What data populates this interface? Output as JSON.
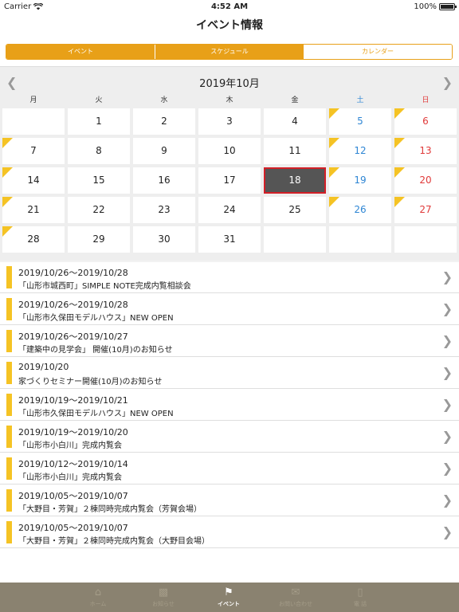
{
  "status": {
    "carrier": "Carrier",
    "time": "4:52 AM",
    "battery": "100%"
  },
  "nav": {
    "title": "イベント情報"
  },
  "segments": [
    "イベント",
    "スケジュール",
    "カレンダー"
  ],
  "calendar": {
    "month": "2019年10月",
    "weekdays": [
      "月",
      "火",
      "水",
      "木",
      "金",
      "土",
      "日"
    ],
    "days": [
      {
        "d": "",
        "flag": false
      },
      {
        "d": "1",
        "flag": false
      },
      {
        "d": "2",
        "flag": false
      },
      {
        "d": "3",
        "flag": false
      },
      {
        "d": "4",
        "flag": false
      },
      {
        "d": "5",
        "flag": true
      },
      {
        "d": "6",
        "flag": true
      },
      {
        "d": "7",
        "flag": true
      },
      {
        "d": "8",
        "flag": false
      },
      {
        "d": "9",
        "flag": false
      },
      {
        "d": "10",
        "flag": false
      },
      {
        "d": "11",
        "flag": false
      },
      {
        "d": "12",
        "flag": true
      },
      {
        "d": "13",
        "flag": true
      },
      {
        "d": "14",
        "flag": true
      },
      {
        "d": "15",
        "flag": false
      },
      {
        "d": "16",
        "flag": false
      },
      {
        "d": "17",
        "flag": false
      },
      {
        "d": "18",
        "flag": false,
        "selected": true
      },
      {
        "d": "19",
        "flag": true
      },
      {
        "d": "20",
        "flag": true
      },
      {
        "d": "21",
        "flag": true
      },
      {
        "d": "22",
        "flag": false
      },
      {
        "d": "23",
        "flag": false
      },
      {
        "d": "24",
        "flag": false
      },
      {
        "d": "25",
        "flag": false
      },
      {
        "d": "26",
        "flag": true
      },
      {
        "d": "27",
        "flag": true
      },
      {
        "d": "28",
        "flag": true
      },
      {
        "d": "29",
        "flag": false
      },
      {
        "d": "30",
        "flag": false
      },
      {
        "d": "31",
        "flag": false
      },
      {
        "d": "",
        "flag": false
      },
      {
        "d": "",
        "flag": false
      },
      {
        "d": "",
        "flag": false
      }
    ]
  },
  "events": [
    {
      "date": "2019/10/26〜2019/10/28",
      "title": "「山形市城西町」SIMPLE NOTE完成内覧相談会"
    },
    {
      "date": "2019/10/26〜2019/10/28",
      "title": "「山形市久保田モデルハウス」NEW OPEN"
    },
    {
      "date": "2019/10/26〜2019/10/27",
      "title": "「建築中の見学会」 開催(10月)のお知らせ"
    },
    {
      "date": "2019/10/20",
      "title": "家づくりセミナー開催(10月)のお知らせ"
    },
    {
      "date": "2019/10/19〜2019/10/21",
      "title": "「山形市久保田モデルハウス」NEW OPEN"
    },
    {
      "date": "2019/10/19〜2019/10/20",
      "title": "「山形市小白川」完成内覧会"
    },
    {
      "date": "2019/10/12〜2019/10/14",
      "title": "「山形市小白川」完成内覧会"
    },
    {
      "date": "2019/10/05〜2019/10/07",
      "title": "「大野目・芳賀」２棟同時完成内覧会（芳賀会場）"
    },
    {
      "date": "2019/10/05〜2019/10/07",
      "title": "「大野目・芳賀」２棟同時完成内覧会（大野目会場）"
    }
  ],
  "tabs": [
    {
      "label": "ホーム",
      "icon": "home-icon"
    },
    {
      "label": "お知らせ",
      "icon": "chat-bubbles-icon"
    },
    {
      "label": "イベント",
      "icon": "flag-icon"
    },
    {
      "label": "お問い合わせ",
      "icon": "mail-icon"
    },
    {
      "label": "電 話",
      "icon": "phone-icon"
    }
  ],
  "colors": {
    "accent": "#e8a018",
    "flag": "#f5c324",
    "tabbar": "#8a8270",
    "saturday": "#2f86d4",
    "sunday": "#e03a3a",
    "selected_border": "#d21f27"
  }
}
